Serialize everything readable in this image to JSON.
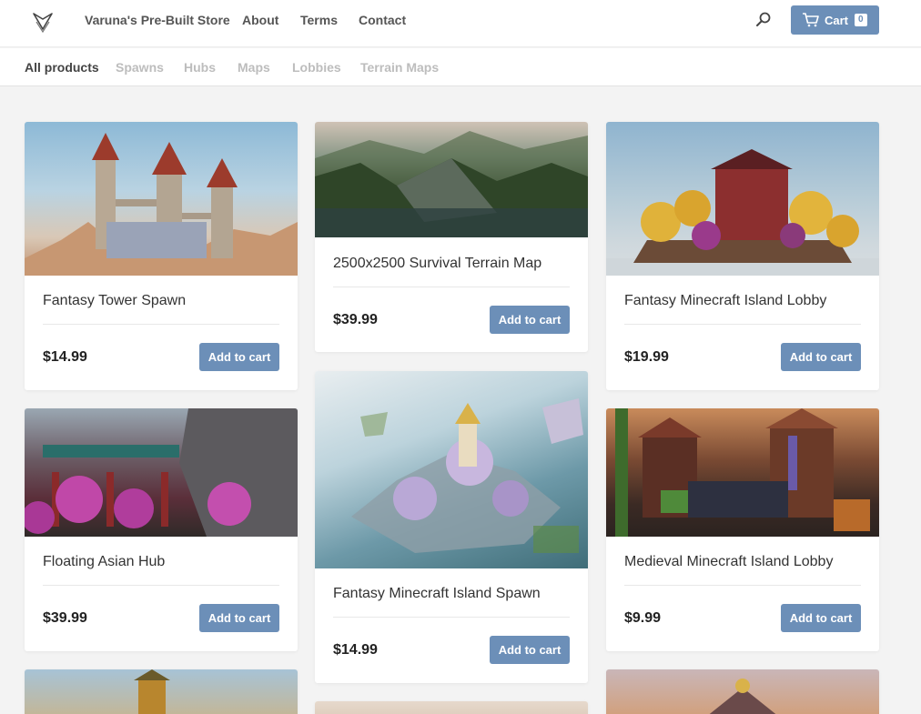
{
  "header": {
    "nav": [
      "Varuna's Pre-Built Store",
      "About",
      "Terms",
      "Contact"
    ],
    "cart_label": "Cart",
    "cart_count": "0"
  },
  "categories": [
    "All products",
    "Spawns",
    "Hubs",
    "Maps",
    "Lobbies",
    "Terrain Maps"
  ],
  "products": [
    {
      "title": "Fantasy Tower Spawn",
      "price": "$14.99",
      "button": "Add to cart"
    },
    {
      "title": "2500x2500 Survival Terrain Map",
      "price": "$39.99",
      "button": "Add to cart"
    },
    {
      "title": "Fantasy Minecraft Island Lobby",
      "price": "$19.99",
      "button": "Add to cart"
    },
    {
      "title": "Floating Asian Hub",
      "price": "$39.99",
      "button": "Add to cart"
    },
    {
      "title": "Fantasy Minecraft Island Spawn",
      "price": "$14.99",
      "button": "Add to cart"
    },
    {
      "title": "Medieval Minecraft Island Lobby",
      "price": "$9.99",
      "button": "Add to cart"
    }
  ],
  "colors": {
    "accent": "#6c8fb8",
    "background": "#f3f3f3",
    "active_category": "#444444",
    "inactive_category": "#bdbdbd"
  },
  "icons": [
    "logo-icon",
    "search-icon",
    "cart-icon"
  ]
}
